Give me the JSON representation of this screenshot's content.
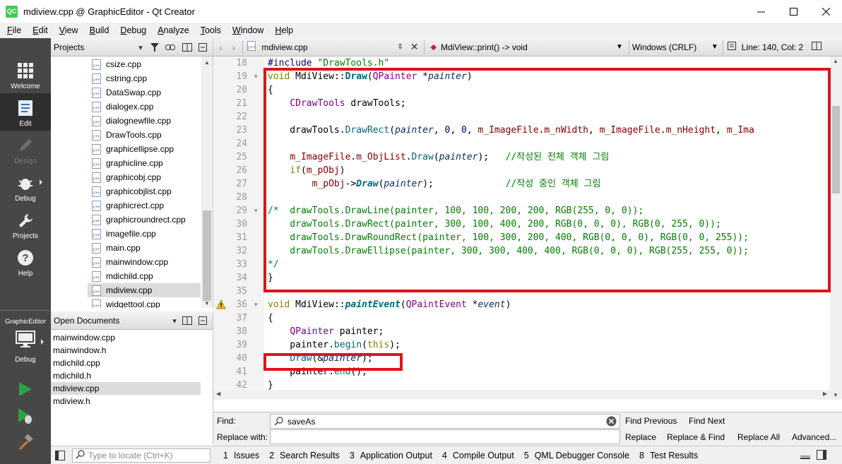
{
  "window": {
    "title": "mdiview.cpp @ GraphicEditor - Qt Creator",
    "logo": "QC"
  },
  "menu": [
    "File",
    "Edit",
    "View",
    "Build",
    "Debug",
    "Analyze",
    "Tools",
    "Window",
    "Help"
  ],
  "menu_mnemonics": [
    "F",
    "E",
    "V",
    "B",
    "D",
    "A",
    "T",
    "W",
    "H"
  ],
  "modes": [
    {
      "label": "Welcome",
      "icon": "grid-icon"
    },
    {
      "label": "Edit",
      "icon": "document-icon"
    },
    {
      "label": "Design",
      "icon": "pencil-icon"
    },
    {
      "label": "Debug",
      "icon": "bug-icon"
    },
    {
      "label": "Projects",
      "icon": "wrench-icon"
    },
    {
      "label": "Help",
      "icon": "question-icon"
    }
  ],
  "kit": {
    "project": "GraphicEditor",
    "config": "Debug"
  },
  "projects": {
    "header": "Projects",
    "files": [
      "csize.cpp",
      "cstring.cpp",
      "DataSwap.cpp",
      "dialogex.cpp",
      "dialognewfile.cpp",
      "DrawTools.cpp",
      "graphicellipse.cpp",
      "graphicline.cpp",
      "graphicobj.cpp",
      "graphicobjlist.cpp",
      "graphicrect.cpp",
      "graphicroundrect.cpp",
      "imagefile.cpp",
      "main.cpp",
      "mainwindow.cpp",
      "mdichild.cpp",
      "mdiview.cpp",
      "widgettool.cpp"
    ],
    "selected": "mdiview.cpp"
  },
  "open_documents": {
    "header": "Open Documents",
    "files": [
      "mainwindow.cpp",
      "mainwindow.h",
      "mdichild.cpp",
      "mdichild.h",
      "mdiview.cpp",
      "mdiview.h"
    ],
    "selected": "mdiview.cpp"
  },
  "locator": {
    "placeholder": "Type to locate (Ctrl+K)"
  },
  "editor_bar": {
    "file": "mdiview.cpp",
    "symbol": "MdiView::print() -> void",
    "encoding": "Windows (CRLF)",
    "position": "Line: 140, Col: 2"
  },
  "line_numbers": [
    "18",
    "19",
    "20",
    "21",
    "22",
    "23",
    "24",
    "25",
    "26",
    "27",
    "28",
    "29",
    "30",
    "31",
    "32",
    "33",
    "34",
    "35",
    "36",
    "37",
    "38",
    "39",
    "40",
    "41",
    "42"
  ],
  "code": {
    "l18": {
      "a": "#include ",
      "b": "\"DrawTools.h\""
    },
    "l19": {
      "a": "void",
      "b": " MdiView",
      "c": "::",
      "d": "Draw",
      "e": "(",
      "f": "QPainter",
      "g": " *",
      "h": "painter",
      "i": ")"
    },
    "l20": "{",
    "l21": {
      "a": "    ",
      "b": "CDrawTools",
      "c": " drawTools;"
    },
    "l23": {
      "a": "    drawTools.",
      "b": "DrawRect",
      "c": "(",
      "d": "painter",
      "e": ", ",
      "f": "0",
      "g": ", ",
      "h": "0",
      "i": ", ",
      "j": "m_ImageFile",
      "k": ".",
      "l": "m_nWidth",
      "m": ", ",
      "n": "m_ImageFile",
      "o": ".",
      "p": "m_nHeight",
      "q": ", ",
      "r": "m_Ima"
    },
    "l25": {
      "a": "    ",
      "b": "m_ImageFile",
      "c": ".",
      "d": "m_ObjList",
      "e": ".",
      "f": "Draw",
      "g": "(",
      "h": "painter",
      "i": ");   ",
      "j": "//작성된 전체 객체 그림"
    },
    "l26": {
      "a": "    ",
      "b": "if",
      "c": "(",
      "d": "m_pObj",
      "e": ")"
    },
    "l27": {
      "a": "        ",
      "b": "m_pObj",
      "c": "->",
      "d": "Draw",
      "e": "(",
      "f": "painter",
      "g": ");             ",
      "h": "//작성 중인 객체 그림"
    },
    "l29": "/*  drawTools.DrawLine(painter, 100, 100, 200, 200, RGB(255, 0, 0));",
    "l30": "    drawTools.DrawRect(painter, 300, 100, 400, 200, RGB(0, 0, 0), RGB(0, 255, 0));",
    "l31": "    drawTools.DrawRoundRect(painter, 100, 300, 200, 400, RGB(0, 0, 0), RGB(0, 0, 255));",
    "l32": "    drawTools.DrawEllipse(painter, 300, 300, 400, 400, RGB(0, 0, 0), RGB(255, 255, 0));",
    "l33": "*/",
    "l34": "}",
    "l36": {
      "a": "void",
      "b": " MdiView",
      "c": "::",
      "d": "paintEvent",
      "e": "(",
      "f": "QPaintEvent",
      "g": " *",
      "h": "event",
      "i": ")"
    },
    "l37": "{",
    "l38": {
      "a": "    ",
      "b": "QPainter",
      "c": " painter;"
    },
    "l39": {
      "a": "    painter.",
      "b": "begin",
      "c": "(",
      "d": "this",
      "e": ");"
    },
    "l40": {
      "a": "    ",
      "b": "Draw",
      "c": "(&",
      "d": "painter",
      "e": ");"
    },
    "l41": {
      "a": "    painter.",
      "b": "end",
      "c": "();"
    },
    "l42": "}"
  },
  "find": {
    "find_label": "Find:",
    "replace_label": "Replace with:",
    "find_value": "saveAs",
    "find_previous": "Find Previous",
    "find_next": "Find Next",
    "replace": "Replace",
    "replace_find": "Replace & Find",
    "replace_all": "Replace All",
    "advanced": "Advanced..."
  },
  "output_tabs": [
    {
      "num": "1",
      "label": "Issues"
    },
    {
      "num": "2",
      "label": "Search Results"
    },
    {
      "num": "3",
      "label": "Application Output"
    },
    {
      "num": "4",
      "label": "Compile Output"
    },
    {
      "num": "5",
      "label": "QML Debugger Console"
    },
    {
      "num": "8",
      "label": "Test Results"
    }
  ],
  "colors": {
    "highlight_box": "#e0121b",
    "mode_bar": "#474747",
    "run_green": "#2ea043"
  }
}
